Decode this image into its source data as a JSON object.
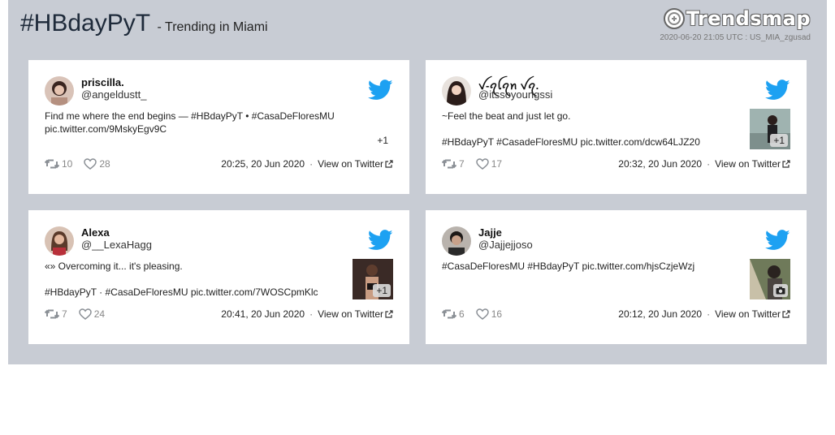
{
  "header": {
    "hashtag": "#HBdayPyT",
    "subtitle": "- Trending in Miami",
    "brand": "Trendsmap",
    "meta": "2020-06-20 21:05 UTC : US_MIA_zgusad"
  },
  "tweets": [
    {
      "name": "priscilla.",
      "handle": "@angeldustt_",
      "text": "Find me where the end begins — #HBdayPyT • #CasaDeFloresMU\npic.twitter.com/9MskyEgv9C",
      "media_label": "+1",
      "retweets": "10",
      "likes": "28",
      "time": "20:25, 20 Jun 2020",
      "view_label": "View on Twitter"
    },
    {
      "name": "ꪜ-ꪖꪶꪖꪀ ꪜꪖ.",
      "handle": "@itssoyoungssi",
      "text": "~Feel the beat and just let go.\n\n#HBdayPyT #CasadeFloresMU pic.twitter.com/dcw64LJZ20",
      "media_label": "+1",
      "retweets": "7",
      "likes": "17",
      "time": "20:32, 20 Jun 2020",
      "view_label": "View on Twitter"
    },
    {
      "name": "Alexa ",
      "handle": "@__LexaHagg",
      "text": "«» Overcoming it... it's pleasing.\n\n#HBdayPyT · #CasaDeFloresMU pic.twitter.com/7WOSCpmKlc",
      "media_label": "+1",
      "retweets": "7",
      "likes": "24",
      "time": "20:41, 20 Jun 2020",
      "view_label": "View on Twitter"
    },
    {
      "name": "Jajje",
      "handle": "@Jajjejjoso",
      "text": "#CasaDeFloresMU #HBdayPyT pic.twitter.com/hjsCzjeWzj",
      "retweets": "6",
      "likes": "16",
      "time": "20:12, 20 Jun 2020",
      "view_label": "View on Twitter"
    }
  ],
  "icons": {
    "bird": "twitter-bird-icon",
    "retweet": "retweet-icon",
    "like": "heart-icon",
    "external": "external-link-icon",
    "camera": "camera-icon"
  },
  "colors": {
    "panel": "#c8ccd4",
    "twitter_blue": "#1da1f2"
  }
}
